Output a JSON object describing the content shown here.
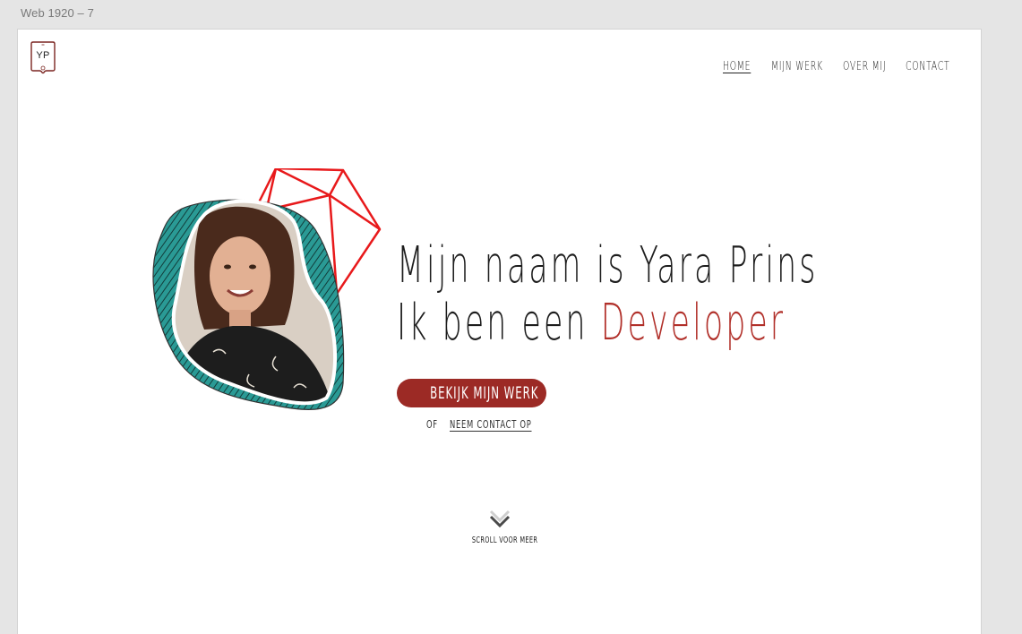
{
  "frame": {
    "label": "Web 1920 – 7"
  },
  "logo": {
    "text": "YP"
  },
  "nav": {
    "items": [
      {
        "label": "HOME",
        "active": true
      },
      {
        "label": "MIJN WERK",
        "active": false
      },
      {
        "label": "OVER MIJ",
        "active": false
      },
      {
        "label": "CONTACT",
        "active": false
      }
    ]
  },
  "hero": {
    "line1": "Mijn naam is Yara Prins",
    "line2_prefix": "Ik ben een ",
    "line2_accent": "Developer",
    "cta_label": "BEKIJK MIJN WERK",
    "or_text": "OF",
    "contact_link": "NEEM CONTACT OP"
  },
  "scroll": {
    "label": "SCROLL VOOR MEER",
    "icon": "chevron-down-icon"
  },
  "colors": {
    "accent": "#b1302a",
    "button": "#9c2a25",
    "teal": "#1f8a86",
    "polygon": "#e8191b"
  }
}
